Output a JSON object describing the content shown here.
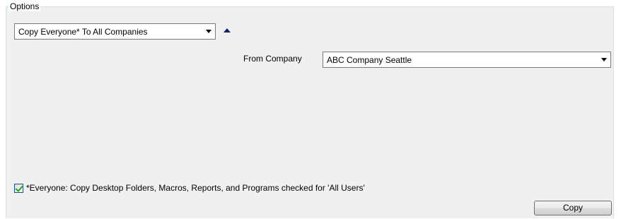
{
  "options_group": {
    "title": "Options"
  },
  "copy_mode": {
    "selected": "Copy Everyone* To All Companies"
  },
  "from_company": {
    "label": "From Company",
    "selected": "ABC Company Seattle"
  },
  "everyone_checkbox": {
    "checked": true,
    "label": "*Everyone: Copy Desktop Folders, Macros, Reports, and Programs checked for 'All Users'"
  },
  "actions": {
    "copy_label": "Copy"
  },
  "colors": {
    "group_background": "#f0f0f0",
    "group_border": "#d5dfe5",
    "toggle_arrow": "#0a246a",
    "check_mark": "#21a121"
  },
  "icons": {
    "collapse_toggle": "triangle-up-icon",
    "combo_arrow": "chevron-down-icon"
  }
}
